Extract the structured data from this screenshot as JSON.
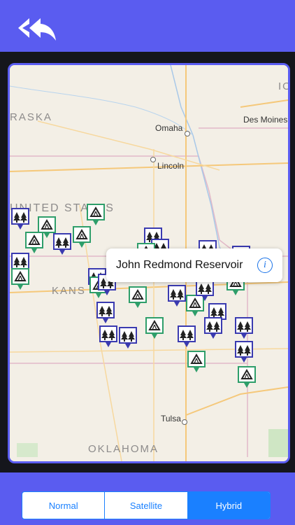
{
  "nav": {
    "back_icon": "double-reply-arrow-icon"
  },
  "map": {
    "region_labels": [
      "RASKA",
      "UNITED STATES",
      "KANS",
      "OKLAHOMA",
      "IO"
    ],
    "cities": [
      "Omaha",
      "Lincoln",
      "Des Moines",
      "Tulsa"
    ],
    "marker_types": [
      "camping-tent-icon",
      "pine-trees-icon"
    ],
    "colors": {
      "tent_marker": "#2e9e6a",
      "tree_marker": "#3a3ab0",
      "accent": "#5a5cf0"
    }
  },
  "callout": {
    "title": "John Redmond Reservoir",
    "info_icon": "info-icon"
  },
  "map_type": {
    "options": [
      "Normal",
      "Satellite",
      "Hybrid"
    ],
    "selected": "Hybrid"
  }
}
